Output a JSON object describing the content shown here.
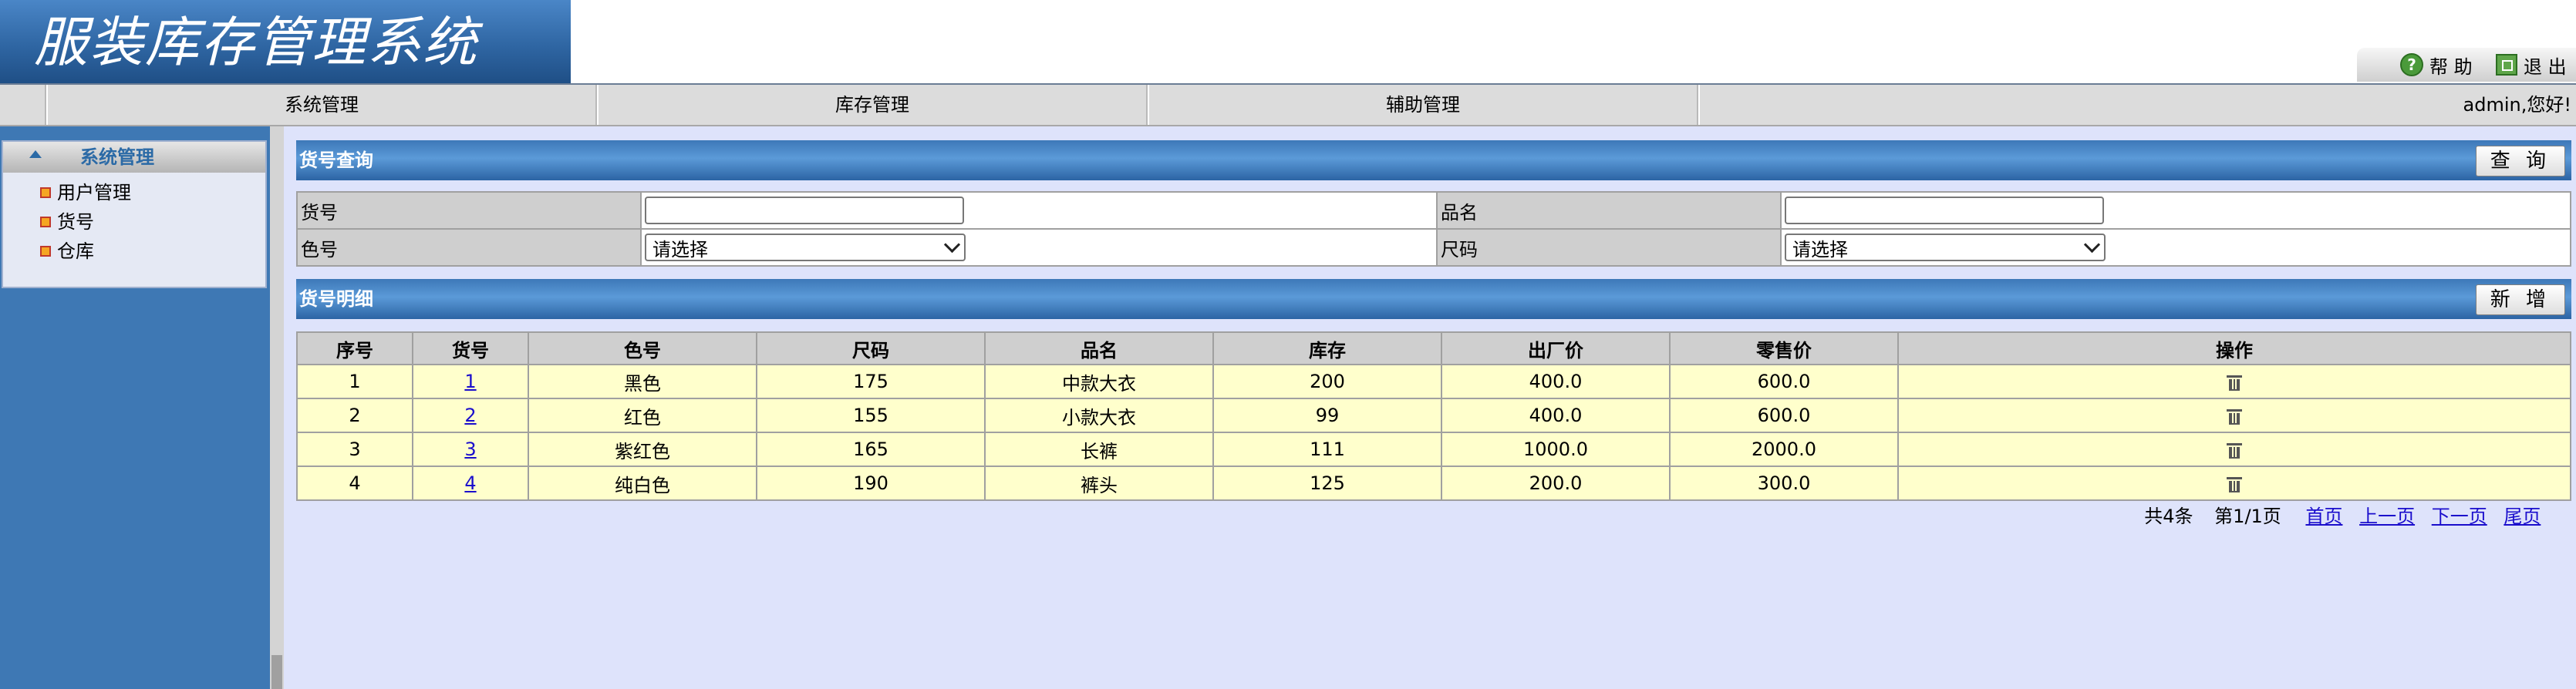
{
  "app": {
    "title": "服装库存管理系统"
  },
  "topbar": {
    "help_label": "帮 助",
    "exit_label": "退 出"
  },
  "nav": {
    "items": [
      "系统管理",
      "库存管理",
      "辅助管理"
    ],
    "welcome": "admin,您好!"
  },
  "sidebar": {
    "title": "系统管理",
    "items": [
      "用户管理",
      "货号",
      "仓库"
    ]
  },
  "query": {
    "title": "货号查询",
    "search_button": "查 询",
    "fields": {
      "code_label": "货号",
      "code_value": "",
      "name_label": "品名",
      "name_value": "",
      "color_label": "色号",
      "color_selected": "请选择",
      "size_label": "尺码",
      "size_selected": "请选择"
    }
  },
  "detail": {
    "title": "货号明细",
    "add_button": "新 增",
    "columns": [
      "序号",
      "货号",
      "色号",
      "尺码",
      "品名",
      "库存",
      "出厂价",
      "零售价",
      "操作"
    ],
    "rows": [
      [
        "1",
        "1",
        "黑色",
        "175",
        "中款大衣",
        "200",
        "400.0",
        "600.0"
      ],
      [
        "2",
        "2",
        "红色",
        "155",
        "小款大衣",
        "99",
        "400.0",
        "600.0"
      ],
      [
        "3",
        "3",
        "紫红色",
        "165",
        "长裤",
        "111",
        "1000.0",
        "2000.0"
      ],
      [
        "4",
        "4",
        "纯白色",
        "190",
        "裤头",
        "125",
        "200.0",
        "300.0"
      ]
    ]
  },
  "pager": {
    "total": "共4条",
    "page": "第1/1页",
    "first": "首页",
    "prev": "上一页",
    "next": "下一页",
    "last": "尾页"
  }
}
